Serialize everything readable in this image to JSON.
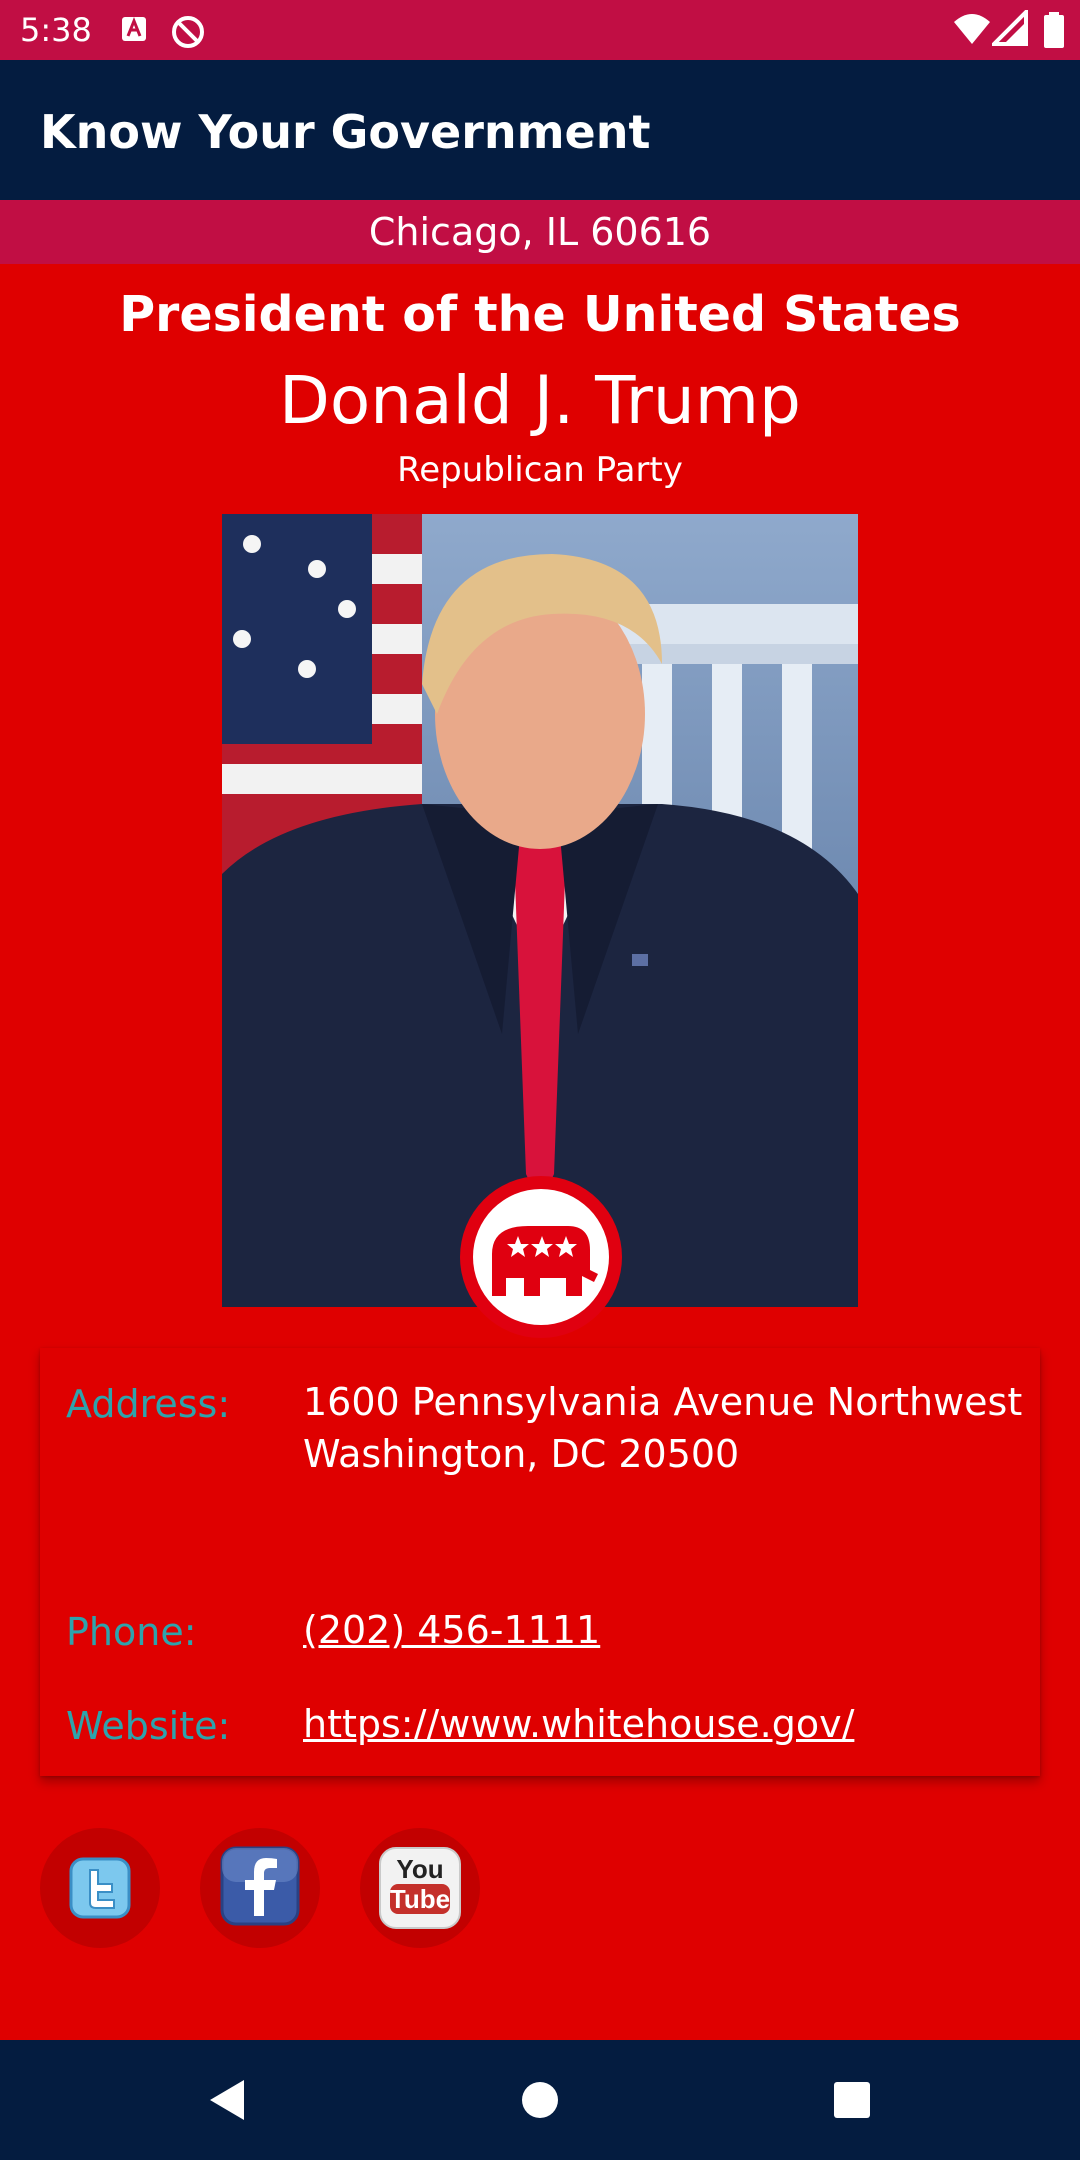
{
  "status_bar": {
    "time": "5:38",
    "icons": [
      "a-badge-icon",
      "sync-disabled-icon",
      "wifi-icon",
      "signal-icon",
      "battery-icon"
    ]
  },
  "app_bar": {
    "title": "Know Your Government"
  },
  "location": {
    "text": "Chicago, IL 60616"
  },
  "official": {
    "office": "President of the United States",
    "name": "Donald J. Trump",
    "party": "Republican Party",
    "party_logo_icon": "republican-elephant-icon"
  },
  "details": {
    "address_label": "Address:",
    "address_line1": "1600 Pennsylvania Avenue Northwest",
    "address_line2": "Washington, DC 20500",
    "phone_label": "Phone:",
    "phone_value": "(202) 456-1111",
    "website_label": "Website:",
    "website_value": "https://www.whitehouse.gov/"
  },
  "social": {
    "youtube_you": "You",
    "youtube_tube": "Tube"
  },
  "nav": {
    "icons": [
      "back-icon",
      "home-icon",
      "recents-icon"
    ]
  },
  "colors": {
    "background": "#DF0000",
    "status_bar": "#C10E44",
    "app_bar": "#041C40",
    "label_teal": "#2EA3AC"
  }
}
